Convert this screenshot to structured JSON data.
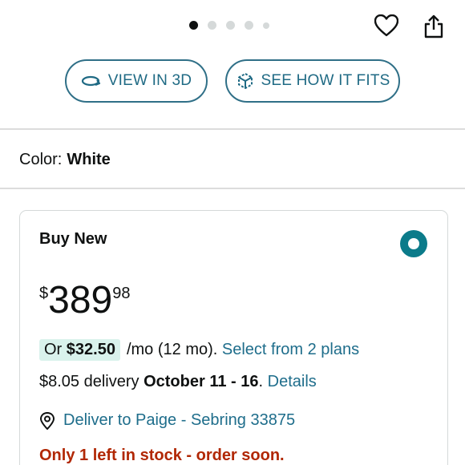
{
  "carousel": {
    "dot_count": 5,
    "active_index": 0
  },
  "actions": {
    "heart_icon": "heart-icon",
    "share_icon": "share-icon"
  },
  "buttons": {
    "view_3d": {
      "label": "VIEW IN 3D",
      "icon": "rotate-3d-icon"
    },
    "see_fits": {
      "label": "SEE HOW IT FITS",
      "icon": "cube-ar-icon"
    }
  },
  "color": {
    "label": "Color:",
    "value": "White"
  },
  "buy_box": {
    "title": "Buy New",
    "selected": true,
    "price": {
      "symbol": "$",
      "whole": "389",
      "fraction": "98"
    },
    "monthly": {
      "prefix": "Or",
      "amount": "$32.50",
      "term": "/mo (12 mo).",
      "link": "Select from 2 plans"
    },
    "delivery": {
      "fee": "$8.05 delivery",
      "dates": "October 11 - 16",
      "separator": ".",
      "link": "Details"
    },
    "deliver_to": {
      "icon": "location-pin-icon",
      "text": "Deliver to Paige - Sebring 33875"
    },
    "stock_warning": "Only 1 left in stock - order soon."
  },
  "colors": {
    "accent": "#1e6d8b",
    "radio": "#0b7b8a",
    "stock": "#b12704",
    "highlight": "#d9f2ec"
  }
}
